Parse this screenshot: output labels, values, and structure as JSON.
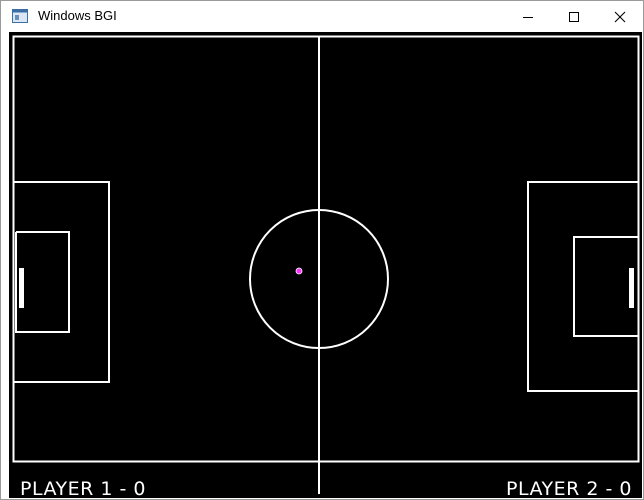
{
  "window": {
    "title": "Windows BGI",
    "app_icon": "window-app-icon"
  },
  "caption_buttons": {
    "minimize": "minimize-icon",
    "maximize": "maximize-icon",
    "close": "close-icon"
  },
  "game": {
    "background": "#000000",
    "line_color": "#ffffff",
    "ball_color": "#ff33ff",
    "player1_score": "PLAYER 1 - 0",
    "player2_score": "PLAYER 2 - 0"
  }
}
